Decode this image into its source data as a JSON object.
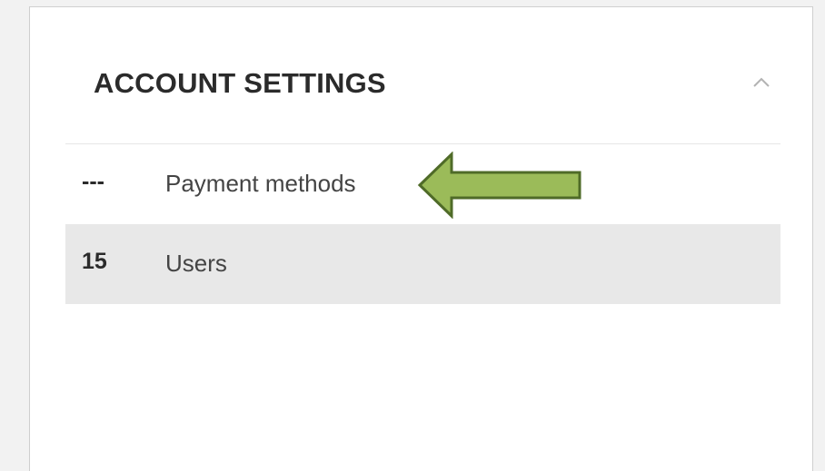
{
  "panel": {
    "title": "ACCOUNT SETTINGS",
    "collapse_icon": "chevron-up-icon"
  },
  "items": [
    {
      "count": "---",
      "label": "Payment methods",
      "selected": false
    },
    {
      "count": "15",
      "label": "Users",
      "selected": true
    }
  ],
  "annotation": {
    "icon": "left-arrow-annotation",
    "fill_color": "#9bbb59",
    "stroke_color": "#4f6b28"
  },
  "colors": {
    "selected_row": "#e8e8e8",
    "panel_background": "#ffffff",
    "page_background": "#f2f2f2"
  }
}
